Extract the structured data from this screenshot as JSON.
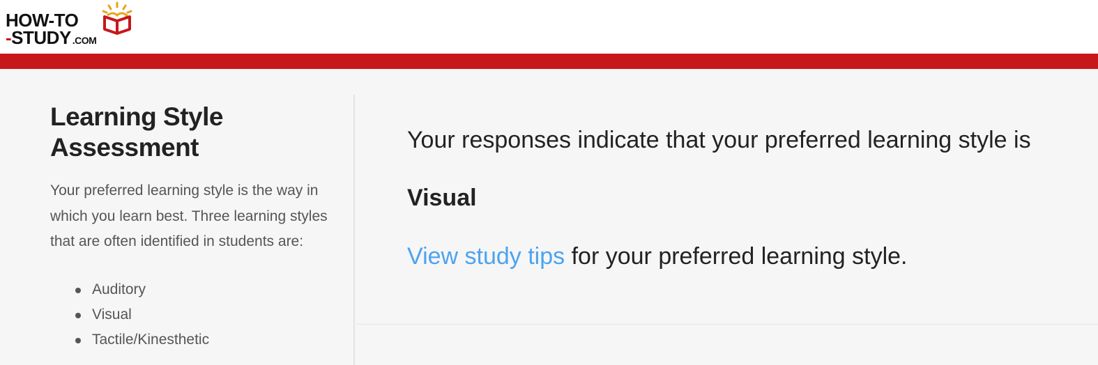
{
  "logo": {
    "line1": "HOW-TO",
    "line2_dash": "-",
    "line2": "STUDY",
    "dotcom": ".COM",
    "brand_red": "#c8171b"
  },
  "sidebar": {
    "title": "Learning Style Assessment",
    "description": "Your preferred learning style is the way in which you learn best. Three learning styles that are often identified in students are:",
    "styles": [
      "Auditory",
      "Visual",
      "Tactile/Kinesthetic"
    ]
  },
  "result": {
    "intro": "Your responses indicate that your preferred learning style is",
    "style": "Visual",
    "tips_link": "View study tips",
    "tips_suffix": " for your preferred learning style."
  },
  "colors": {
    "accent_link": "#4da3ef",
    "header_bar": "#c8171b",
    "content_bg": "#f6f6f6"
  }
}
